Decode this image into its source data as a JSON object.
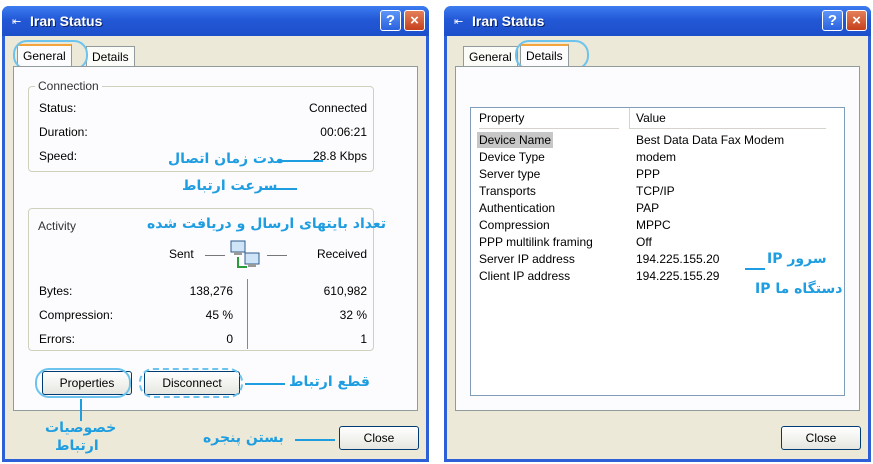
{
  "left_window": {
    "title": "Iran Status",
    "title_buttons": {
      "help": "?",
      "close": "×"
    },
    "tabs": [
      "General",
      "Details"
    ],
    "connection": {
      "label": "Connection",
      "status_label": "Status:",
      "status_value": "Connected",
      "duration_label": "Duration:",
      "duration_value": "00:06:21",
      "speed_label": "Speed:",
      "speed_value": "28.8 Kbps"
    },
    "activity": {
      "label": "Activity",
      "sent": "Sent",
      "received": "Received",
      "bytes_label": "Bytes:",
      "bytes_sent": "138,276",
      "bytes_received": "610,982",
      "compression_label": "Compression:",
      "compression_sent": "45 %",
      "compression_received": "32 %",
      "errors_label": "Errors:",
      "errors_sent": "0",
      "errors_received": "1"
    },
    "buttons": {
      "properties": "Properties",
      "disconnect": "Disconnect",
      "close": "Close"
    },
    "annotations": {
      "duration": "مدت زمان اتصال",
      "speed": "سرعت ارتباط",
      "activity": "تعداد بایتهای ارسال و دریافت شده",
      "disconnect": "قطع ارتباط",
      "properties_line1": "خصوصیات",
      "properties_line2": "ارتباط",
      "close": "بستن پنجره"
    }
  },
  "right_window": {
    "title": "Iran Status",
    "title_buttons": {
      "help": "?",
      "close": "×"
    },
    "tabs": [
      "General",
      "Details"
    ],
    "list_headers": {
      "property": "Property",
      "value": "Value"
    },
    "rows": [
      {
        "property": "Device Name",
        "value": "Best Data Data Fax Modem"
      },
      {
        "property": "Device Type",
        "value": "modem"
      },
      {
        "property": "Server type",
        "value": "PPP"
      },
      {
        "property": "Transports",
        "value": "TCP/IP"
      },
      {
        "property": "Authentication",
        "value": "PAP"
      },
      {
        "property": "Compression",
        "value": "MPPC"
      },
      {
        "property": "PPP multilink framing",
        "value": "Off"
      },
      {
        "property": "Server IP address",
        "value": "194.225.155.20"
      },
      {
        "property": "Client IP address",
        "value": "194.225.155.29"
      }
    ],
    "buttons": {
      "close": "Close"
    },
    "annotations": {
      "server_ip": "IP سرور",
      "client_ip": "IP دستگاه ما"
    }
  },
  "colors": {
    "titlebar": "#2358d6",
    "annotation": "#1e9de0",
    "window_bg": "#ece9d8"
  }
}
